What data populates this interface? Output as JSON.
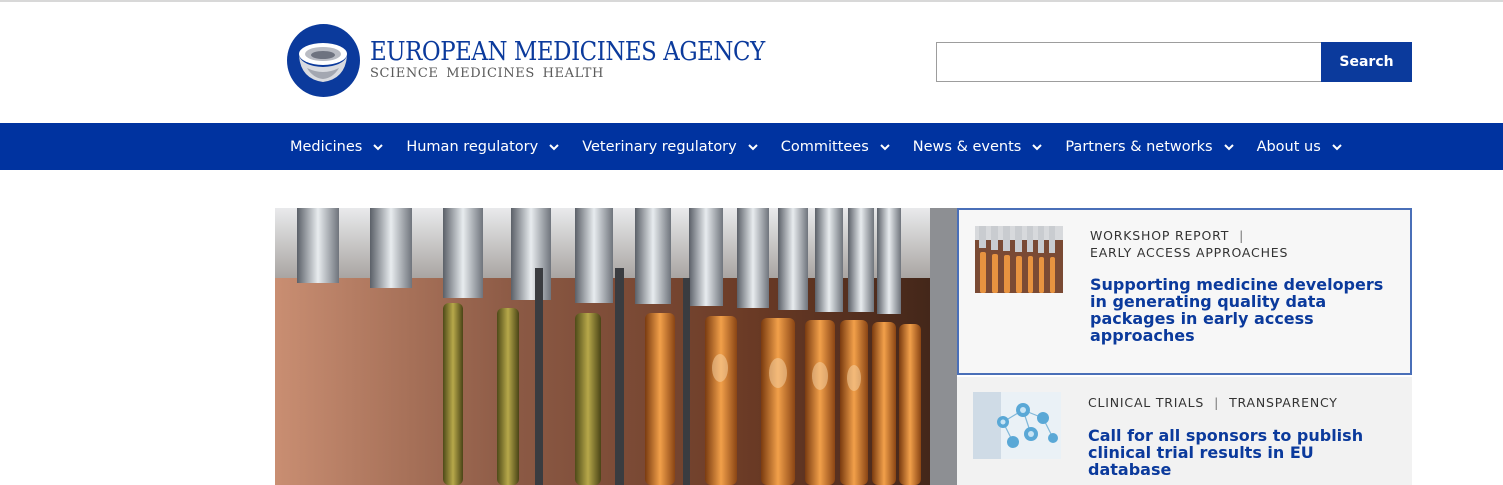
{
  "header": {
    "logo_title": "EUROPEAN MEDICINES AGENCY",
    "logo_subtitle": "SCIENCE MEDICINES HEALTH",
    "search_placeholder": "",
    "search_button": "Search"
  },
  "nav": {
    "items": [
      {
        "label": "Medicines"
      },
      {
        "label": "Human regulatory"
      },
      {
        "label": "Veterinary regulatory"
      },
      {
        "label": "Committees"
      },
      {
        "label": "News & events"
      },
      {
        "label": "Partners & networks"
      },
      {
        "label": "About us"
      }
    ]
  },
  "hero": {
    "image": "pharmaceutical-ampoule-filling-line"
  },
  "cards": [
    {
      "tags": [
        "WORKSHOP REPORT",
        "EARLY ACCESS APPROACHES"
      ],
      "title": "Supporting medicine developers in generating quality data packages in early access approaches",
      "thumb": "ampoule-production-thumbnail"
    },
    {
      "tags": [
        "CLINICAL TRIALS",
        "TRANSPARENCY"
      ],
      "title": "Call for all sponsors to publish clinical trial results in EU database",
      "thumb": "molecular-network-thumbnail"
    }
  ],
  "colors": {
    "brand_blue": "#0033a0",
    "logo_blue": "#0b3a9c",
    "card_border": "#4a6fb8"
  }
}
